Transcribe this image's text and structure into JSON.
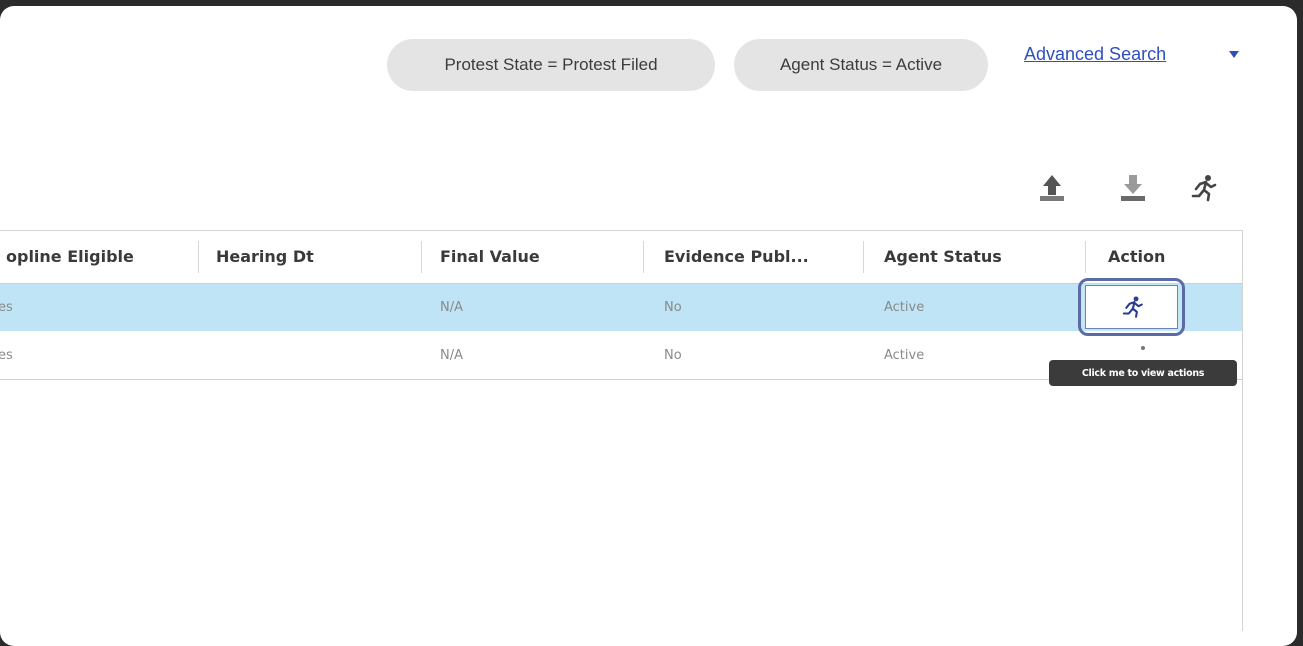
{
  "filters": {
    "chips": [
      "Protest State = Protest Filed",
      "Agent Status = Active"
    ],
    "advanced_search": "Advanced Search"
  },
  "toolbar": {
    "upload_icon": "upload-icon",
    "download_icon": "download-icon",
    "run_icon": "running-person-icon"
  },
  "grid": {
    "headers": [
      "opline Eligible",
      "Hearing Dt",
      "Final Value",
      "Evidence Publ...",
      "Agent Status",
      "Action"
    ],
    "rows": [
      {
        "eligible": "es",
        "hearing_dt": "",
        "final_value": "N/A",
        "evidence": "No",
        "agent_status": "Active",
        "selected": true
      },
      {
        "eligible": "es",
        "hearing_dt": "",
        "final_value": "N/A",
        "evidence": "No",
        "agent_status": "Active",
        "selected": false
      }
    ]
  },
  "tooltip": "Click me to view actions",
  "colors": {
    "selected_row": "#bfe4f5",
    "link": "#2f4fbf",
    "chip": "#e4e4e4",
    "focus_ring": "#5b6ba8"
  }
}
